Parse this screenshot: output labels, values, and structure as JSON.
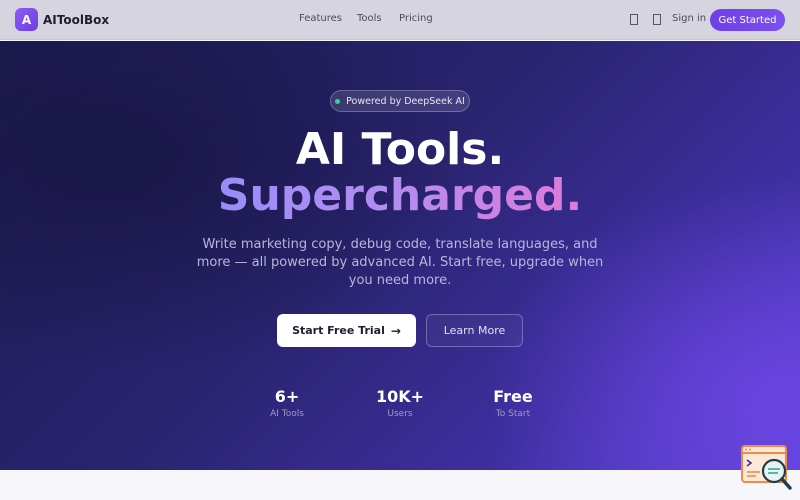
{
  "nav": {
    "logo_letter": "A",
    "brand": "AIToolBox",
    "links": [
      "Features",
      "Tools",
      "Pricing"
    ],
    "icon_1": "unknown-glyph-icon",
    "icon_2": "unknown-glyph-icon",
    "signin": "Sign in",
    "cta": "Get Started"
  },
  "hero": {
    "badge": "Powered by DeepSeek AI",
    "headline_1": "AI Tools.",
    "headline_2": "Supercharged.",
    "subtext": "Write marketing copy, debug code, translate languages, and more — all powered by advanced AI. Start free, upgrade when you need more.",
    "primary_button": "Start Free Trial",
    "primary_arrow": "→",
    "secondary_button": "Learn More",
    "stats": [
      {
        "value": "6+",
        "label": "AI Tools"
      },
      {
        "value": "10K+",
        "label": "Users"
      },
      {
        "value": "Free",
        "label": "To Start"
      }
    ]
  },
  "widget": {
    "icon": "code-search-icon"
  },
  "colors": {
    "accent": "#6d3fe6",
    "badge_dot": "#34d399",
    "gradient_start": "#9b8cf8",
    "gradient_end": "#e07ad8"
  }
}
